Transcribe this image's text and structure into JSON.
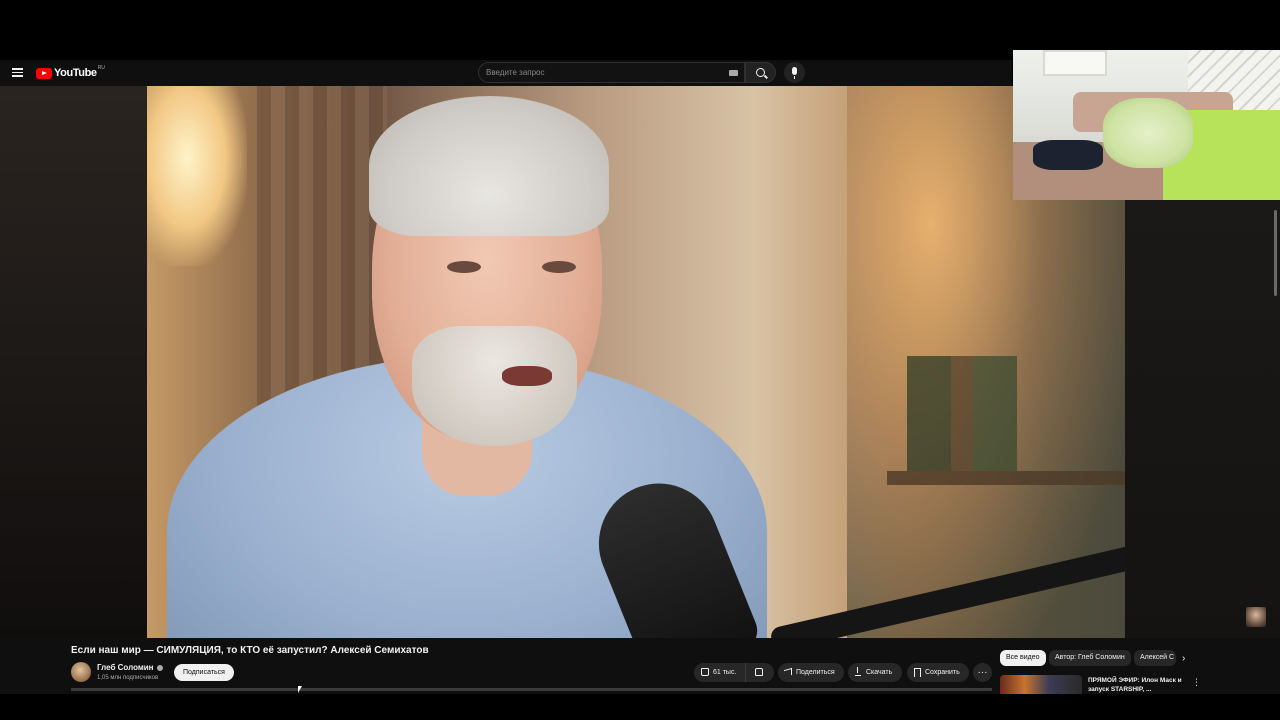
{
  "masthead": {
    "logo_text": "YouTube",
    "region": "RU",
    "search_placeholder": "Введите запрос"
  },
  "video": {
    "title": "Если наш мир — СИМУЛЯЦИЯ, то КТО её запустил? Алексей Семихатов",
    "channel_name": "Глеб Соломин",
    "subscribers": "1,05 млн подписчиков",
    "subscribe_label": "Подписаться"
  },
  "actions": {
    "likes": "61 тыс.",
    "share_label": "Поделиться",
    "download_label": "Скачать",
    "save_label": "Сохранить",
    "more_label": "···"
  },
  "chips": {
    "all": "Все видео",
    "author": "Автор: Глеб Соломин",
    "alexey": "Алексей С",
    "next": "›"
  },
  "recommendation": {
    "title": "ПРЯМОЙ ЭФИР: Илон Маск и запуск STARSHIP, ...",
    "menu": "⋮"
  },
  "icons": {
    "menu": "hamburger-icon",
    "search": "search-icon",
    "mic": "mic-icon",
    "like": "thumbs-up-icon",
    "dislike": "thumbs-down-icon",
    "share": "share-icon",
    "download": "download-icon",
    "save": "bookmark-icon"
  },
  "colors": {
    "brand": "#ff0000",
    "background": "#0f0f0f",
    "pill": "#272727",
    "text": "#f1f1f1"
  }
}
